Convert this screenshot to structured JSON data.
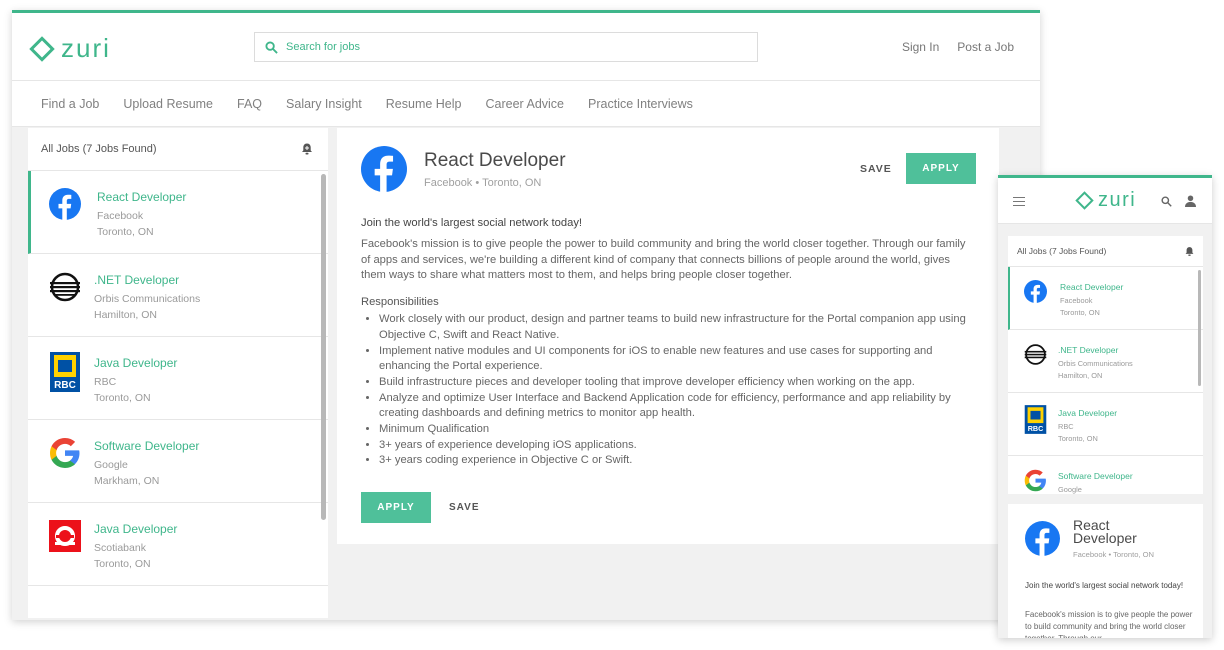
{
  "brand": {
    "name": "zuri",
    "accent": "#3fb68b",
    "button": "#4fc09a"
  },
  "header": {
    "search_placeholder": "Search for jobs",
    "sign_in": "Sign In",
    "post_job": "Post a Job"
  },
  "nav": [
    "Find a Job",
    "Upload Resume",
    "FAQ",
    "Salary Insight",
    "Resume Help",
    "Career Advice",
    "Practice Interviews"
  ],
  "list": {
    "heading": "All Jobs (7 Jobs Found)",
    "jobs": [
      {
        "title": "React Developer",
        "company": "Facebook",
        "location": "Toronto, ON",
        "logo": "facebook-logo"
      },
      {
        "title": ".NET Developer",
        "company": "Orbis Communications",
        "location": "Hamilton, ON",
        "logo": "orbis-logo"
      },
      {
        "title": "Java Developer",
        "company": "RBC",
        "location": "Toronto, ON",
        "logo": "rbc-logo"
      },
      {
        "title": "Software Developer",
        "company": "Google",
        "location": "Markham, ON",
        "logo": "google-logo"
      },
      {
        "title": "Java Developer",
        "company": "Scotiabank",
        "location": "Toronto, ON",
        "logo": "scotiabank-logo"
      }
    ]
  },
  "detail": {
    "title": "React Developer",
    "subtitle": "Facebook • Toronto, ON",
    "save": "SAVE",
    "apply": "APPLY",
    "intro": "Join the world's largest social network today!",
    "description": "Facebook's mission is to give people the power to build community and bring the world closer together. Through our family of apps and services, we're building a different kind of company that connects billions of people around the world, gives them ways to share what matters most to them, and helps bring people closer together.",
    "resp_heading": "Responsibilities",
    "responsibilities": [
      "Work closely with our product, design and partner teams to build new infrastructure for the Portal companion app using Objective C, Swift and React Native.",
      "Implement native modules and UI components for iOS to enable new features and use cases for supporting and enhancing the Portal experience.",
      "Build infrastructure pieces and developer tooling that improve developer efficiency when working on the app.",
      "Analyze and optimize User Interface and Backend Application code for efficiency, performance and app reliability by creating dashboards and defining metrics to monitor app health.",
      "Minimum Qualification",
      "3+ years of experience developing iOS applications.",
      "3+ years coding experience in Objective C or Swift."
    ]
  },
  "mobile": {
    "list_heading": "All Jobs (7 Jobs Found)",
    "detail_title": "React Developer",
    "detail_subtitle": "Facebook • Toronto, ON",
    "intro": "Join the world's largest social network today!",
    "description_preview": "Facebook's mission is to give people the power to build community and bring the world closer together. Through our"
  }
}
